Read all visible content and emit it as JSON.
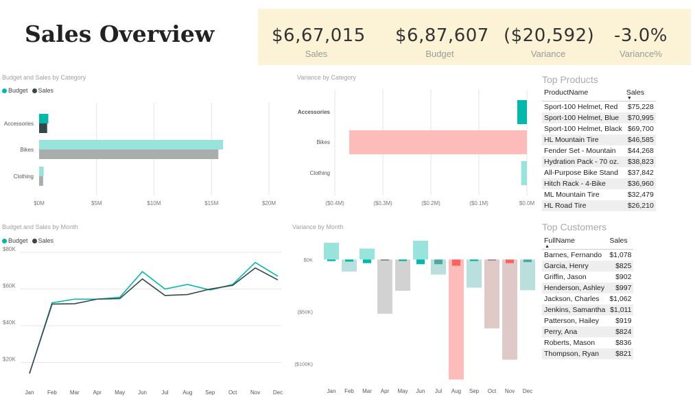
{
  "title": "Sales Overview",
  "kpis": [
    {
      "value": "$6,67,015",
      "label": "Sales"
    },
    {
      "value": "$6,87,607",
      "label": "Budget"
    },
    {
      "value": "($20,592)",
      "label": "Variance"
    },
    {
      "value": "-3.0%",
      "label": "Variance%"
    }
  ],
  "colors": {
    "budget": "#01b8aa",
    "budget_light": "#99e3dd",
    "sales": "#374649",
    "sales_light": "#a9adae",
    "negative": "#fd625e",
    "negative_light": "#fdbbba",
    "kpi_band": "#fcf3d6"
  },
  "chart_data": [
    {
      "type": "bar",
      "title": "Budget and Sales by Category",
      "orientation": "horizontal",
      "legend": [
        "Budget",
        "Sales"
      ],
      "categories": [
        "Accessories",
        "Bikes",
        "Clothing"
      ],
      "series": [
        {
          "name": "Budget",
          "values": [
            0.8,
            16.0,
            0.4
          ]
        },
        {
          "name": "Sales",
          "values": [
            0.7,
            15.6,
            0.35
          ]
        }
      ],
      "x_ticks": [
        "$0M",
        "$5M",
        "$10M",
        "$15M",
        "$20M"
      ],
      "xlim": [
        0,
        20
      ]
    },
    {
      "type": "bar",
      "title": "Variance by Category",
      "orientation": "horizontal",
      "categories": [
        "Accessories",
        "Bikes",
        "Clothing"
      ],
      "values": [
        -0.02,
        -0.37,
        -0.012
      ],
      "x_ticks": [
        "($0.4M)",
        "($0.3M)",
        "($0.2M)",
        "($0.1M)",
        "$0.0M"
      ],
      "xlim": [
        -0.4,
        0
      ]
    },
    {
      "type": "line",
      "title": "Budget and Sales by Month",
      "legend": [
        "Budget",
        "Sales"
      ],
      "categories": [
        "Jan",
        "Feb",
        "Mar",
        "Apr",
        "May",
        "Jun",
        "Jul",
        "Aug",
        "Sep",
        "Oct",
        "Nov",
        "Dec"
      ],
      "series": [
        {
          "name": "Budget",
          "values": [
            14000,
            52500,
            54500,
            54500,
            55500,
            69500,
            60000,
            62500,
            59500,
            62500,
            74500,
            67000
          ]
        },
        {
          "name": "Sales",
          "values": [
            14000,
            51800,
            52000,
            54500,
            54800,
            65500,
            56500,
            57000,
            60000,
            62000,
            71500,
            65000
          ]
        }
      ],
      "y_ticks": [
        "$20K",
        "$40K",
        "$60K",
        "$80K"
      ],
      "ylim": [
        12000,
        80000
      ]
    },
    {
      "type": "bar",
      "title": "Variance by Month",
      "categories": [
        "Jan",
        "Feb",
        "Mar",
        "Apr",
        "May",
        "Jun",
        "Jul",
        "Aug",
        "Sep",
        "Oct",
        "Nov",
        "Dec"
      ],
      "bg_values": [
        16000,
        -11500,
        10500,
        -52000,
        -30000,
        18000,
        -14500,
        -115000,
        -27000,
        -66000,
        -96000,
        -29500
      ],
      "fg_values": [
        -1500,
        -2000,
        -3500,
        -1000,
        -1500,
        -4500,
        -4500,
        -6000,
        -1500,
        -1000,
        -3500,
        -2500
      ],
      "y_ticks": [
        "$0K",
        "($50K)",
        "($100K)"
      ],
      "ylim": [
        -118000,
        20000
      ]
    }
  ],
  "top_products": {
    "title": "Top Products",
    "columns": [
      "ProductName",
      "Sales"
    ],
    "rows": [
      [
        "Sport-100 Helmet, Red",
        "$75,228"
      ],
      [
        "Sport-100 Helmet, Blue",
        "$70,995"
      ],
      [
        "Sport-100 Helmet, Black",
        "$69,700"
      ],
      [
        "HL Mountain Tire",
        "$46,585"
      ],
      [
        "Fender Set - Mountain",
        "$44,268"
      ],
      [
        "Hydration Pack - 70 oz.",
        "$38,823"
      ],
      [
        "All-Purpose Bike Stand",
        "$37,842"
      ],
      [
        "Hitch Rack - 4-Bike",
        "$36,960"
      ],
      [
        "ML Mountain Tire",
        "$32,479"
      ],
      [
        "HL Road Tire",
        "$26,210"
      ]
    ]
  },
  "top_customers": {
    "title": "Top Customers",
    "columns": [
      "FullName",
      "Sales"
    ],
    "rows": [
      [
        "Barnes, Fernando",
        "$1,078"
      ],
      [
        "Garcia, Henry",
        "$825"
      ],
      [
        "Griffin, Jason",
        "$902"
      ],
      [
        "Henderson, Ashley",
        "$997"
      ],
      [
        "Jackson, Charles",
        "$1,062"
      ],
      [
        "Jenkins, Samantha",
        "$1,011"
      ],
      [
        "Patterson, Hailey",
        "$919"
      ],
      [
        "Perry, Ana",
        "$824"
      ],
      [
        "Roberts, Mason",
        "$836"
      ],
      [
        "Thompson, Ryan",
        "$821"
      ]
    ]
  }
}
